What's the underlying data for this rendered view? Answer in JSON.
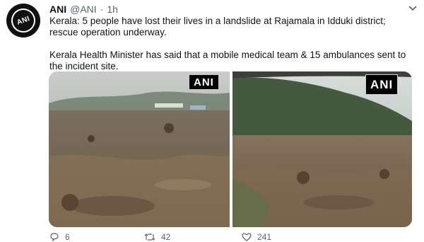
{
  "tweet": {
    "author_name": "ANI",
    "handle": "@ANI",
    "separator": "·",
    "time": "1h",
    "avatar_text": "ANI",
    "paragraph1": "Kerala: 5 people have lost their lives in a landslide at Rajamala in Idduki district; rescue operation underway.",
    "paragraph2": "Kerala Health Minister has said that a mobile medical team & 15 ambulances sent to the incident site.",
    "images": [
      {
        "watermark": "ANI",
        "description_icon": "landslide-photo"
      },
      {
        "watermark": "ANI",
        "description_icon": "landslide-photo"
      }
    ],
    "actions": {
      "reply_count": "6",
      "retweet_count": "42",
      "like_count": "241"
    }
  },
  "colors": {
    "text": "#0f1419",
    "secondary": "#536471",
    "avatar_bg": "#111111"
  }
}
